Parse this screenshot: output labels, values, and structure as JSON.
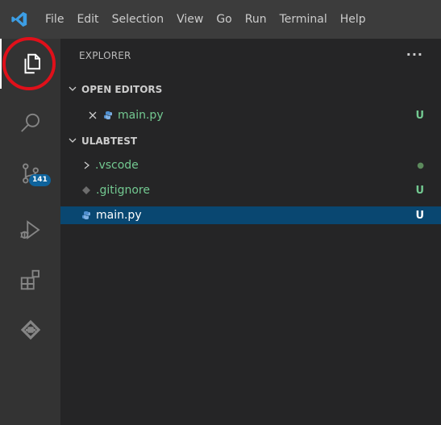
{
  "menubar": {
    "items": [
      "File",
      "Edit",
      "Selection",
      "View",
      "Go",
      "Run",
      "Terminal",
      "Help"
    ]
  },
  "activity": {
    "badge_count": "141"
  },
  "explorer": {
    "title": "EXPLORER",
    "more": "···",
    "open_editors": {
      "label": "OPEN EDITORS",
      "items": [
        {
          "name": "main.py",
          "status": "U"
        }
      ]
    },
    "workspace": {
      "label": "ULABTEST",
      "items": [
        {
          "name": ".vscode",
          "status": "●"
        },
        {
          "name": ".gitignore",
          "status": "U"
        },
        {
          "name": "main.py",
          "status": "U"
        }
      ]
    }
  },
  "colors": {
    "accent": "#0e639c",
    "selection": "#094771",
    "git_untracked": "#73c991",
    "highlight_ring": "#e0101a"
  }
}
